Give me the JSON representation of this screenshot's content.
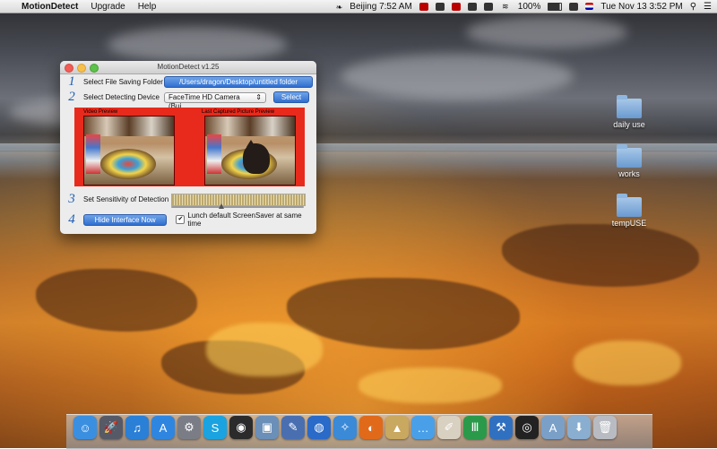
{
  "menubar": {
    "app_name": "MotionDetect",
    "menus": [
      "Upgrade",
      "Help"
    ],
    "location": "Beijing 7:52 AM",
    "battery": "100%",
    "datetime": "Tue Nov 13  3:52 PM"
  },
  "window": {
    "title": "MotionDetect v1.25",
    "step1": {
      "number": "1",
      "label": "Select File Saving Folder",
      "path_button": "/Users/dragon/Desktop/untitled folder"
    },
    "step2": {
      "number": "2",
      "label": "Select Detecting Device",
      "device": "FaceTime HD Camera (Bui...",
      "select_button": "Select"
    },
    "preview": {
      "video_caption": "Video Preview",
      "captured_caption": "Last Captured Picture Preview"
    },
    "step3": {
      "number": "3",
      "label": "Set Sensitivity of Detection",
      "sensitivity_fraction": 0.38
    },
    "step4": {
      "number": "4",
      "hide_button": "Hide Interface Now",
      "checkbox_label": "Lunch default ScreenSaver at same time",
      "checkbox_checked": true
    }
  },
  "desktop_icons": [
    {
      "label": "daily use",
      "icon": "folder-icon"
    },
    {
      "label": "works",
      "icon": "folder-icon"
    },
    {
      "label": "tempUSE",
      "icon": "folder-icon"
    }
  ],
  "dock": [
    {
      "name": "finder-icon",
      "color": "#3b8fe0",
      "glyph": "☺"
    },
    {
      "name": "launchpad-icon",
      "color": "#555a66",
      "glyph": "🚀"
    },
    {
      "name": "itunes-icon",
      "color": "#2a7fd6",
      "glyph": "♫"
    },
    {
      "name": "app-store-icon",
      "color": "#2f86e0",
      "glyph": "A"
    },
    {
      "name": "system-preferences-icon",
      "color": "#7a7d85",
      "glyph": "⚙"
    },
    {
      "name": "skype-icon",
      "color": "#1aa3e0",
      "glyph": "S"
    },
    {
      "name": "dashboard-icon",
      "color": "#2b2b2b",
      "glyph": "◉"
    },
    {
      "name": "preview-icon",
      "color": "#6a8fb8",
      "glyph": "▣"
    },
    {
      "name": "paintbrush-icon",
      "color": "#4a6fb0",
      "glyph": "✎"
    },
    {
      "name": "google-earth-icon",
      "color": "#2a6ac8",
      "glyph": "◍"
    },
    {
      "name": "safari-icon",
      "color": "#3a8ad8",
      "glyph": "✧"
    },
    {
      "name": "firefox-icon",
      "color": "#e06a1a",
      "glyph": "◐"
    },
    {
      "name": "archive-utility-icon",
      "color": "#c9a860",
      "glyph": "▲"
    },
    {
      "name": "messages-icon",
      "color": "#4aa0e8",
      "glyph": "…"
    },
    {
      "name": "textedit-icon",
      "color": "#d8d0c0",
      "glyph": "✐"
    },
    {
      "name": "font-book-icon",
      "color": "#2a9a4a",
      "glyph": "Ⅲ"
    },
    {
      "name": "xcode-icon",
      "color": "#3070c0",
      "glyph": "⚒"
    },
    {
      "name": "motiondetect-icon",
      "color": "#222222",
      "glyph": "◎"
    },
    {
      "name": "applications-folder-icon",
      "color": "#7aa0c8",
      "glyph": "A"
    },
    {
      "name": "downloads-folder-icon",
      "color": "#8aaed0",
      "glyph": "⬇"
    },
    {
      "name": "trash-icon",
      "color": "#b8bcc2",
      "glyph": "🗑"
    }
  ]
}
